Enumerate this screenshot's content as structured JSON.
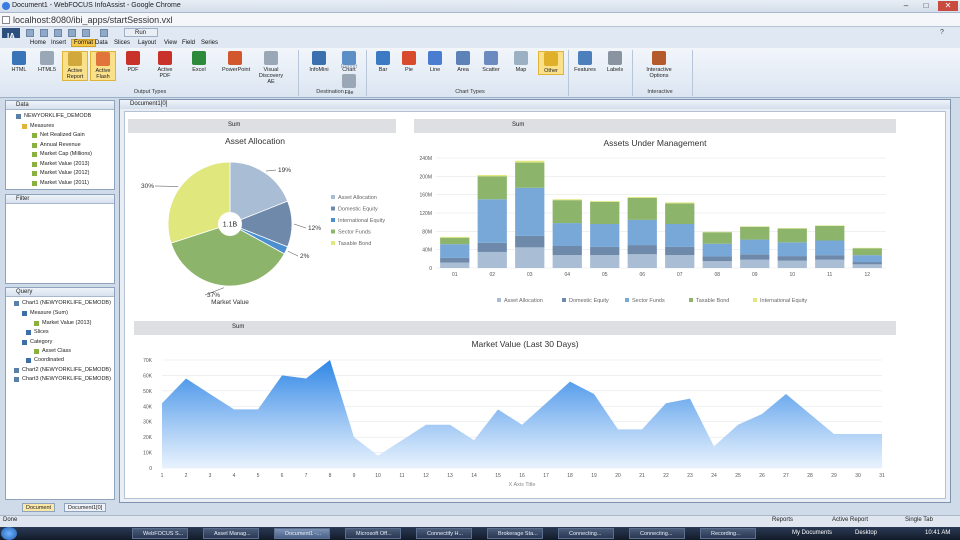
{
  "browser": {
    "title": "Document1 - WebFOCUS InfoAssist - Google Chrome",
    "url": "localhost:8080/ibi_apps/startSession.vxl"
  },
  "app": {
    "logo": "IA",
    "run_label": "Run",
    "menus": [
      "Home",
      "Insert",
      "Format",
      "Data",
      "Slices",
      "Layout",
      "View",
      "Field",
      "Series"
    ],
    "active_menu": "Format",
    "ribbon": {
      "output_types": [
        "HTML",
        "HTML5",
        "Active Report",
        "Active Flash",
        "PDF",
        "Active PDF",
        "Excel",
        "PowerPoint",
        "Visual Discovery AE"
      ],
      "destination": [
        "InfoMini",
        "Chart",
        "Report",
        "File"
      ],
      "chart_types": [
        "Bar",
        "Pie",
        "Line",
        "Area",
        "Scatter",
        "Map",
        "Other"
      ],
      "features": [
        "Features",
        "Labels"
      ],
      "interactive": [
        "Interactive Options"
      ],
      "groups": [
        "Output Types",
        "Destination",
        "Chart Types",
        "Interactive"
      ]
    }
  },
  "panels": {
    "data_label": "Data",
    "filter_label": "Filter",
    "query_label": "Query",
    "data_tree": [
      "NEWYORKLIFE_DEMODB",
      "Measures",
      "Net Realized Gain",
      "Annual Revenue",
      "Market Cap (Millions)",
      "Market Value (2013)",
      "Market Value (2012)",
      "Market Value (2011)"
    ],
    "query_tree": [
      "Chart1 (NEWYORKLIFE_DEMODB)",
      "Measure (Sum)",
      "Market Value (2013)",
      "Slices",
      "Category",
      "Asset Class",
      "Coordinated",
      "Chart2 (NEWYORKLIFE_DEMODB)",
      "Chart3 (NEWYORKLIFE_DEMODB)"
    ],
    "bottom_tabs": [
      "Document",
      "Document1[0]"
    ]
  },
  "document": {
    "tab_label": "Document1[0]",
    "toolbar_sum": "Sum"
  },
  "chart_data": [
    {
      "type": "pie",
      "title": "Asset Allocation",
      "center_label": "1.1B",
      "xlabel": "Market Value",
      "slices": [
        {
          "label": "Asset Allocation",
          "pct": 19,
          "color": "#a9bdd4"
        },
        {
          "label": "Domestic Equity",
          "pct": 12,
          "color": "#6e89aa"
        },
        {
          "label": "International Equity",
          "pct": 2,
          "color": "#4b8fd1"
        },
        {
          "label": "Sector Funds",
          "pct": 37,
          "color": "#8cb46a"
        },
        {
          "label": "Taxable Bond",
          "pct": 30,
          "color": "#dfe77d"
        }
      ],
      "slice_labels": [
        "19%",
        "12%",
        "2%",
        "37%",
        "30%"
      ],
      "legend": [
        "Asset Allocation",
        "Domestic Equity",
        "International Equity",
        "Sector Funds",
        "Taxable Bond"
      ]
    },
    {
      "type": "bar",
      "title": "Assets Under Management",
      "categories": [
        "01",
        "02",
        "03",
        "04",
        "05",
        "06",
        "07",
        "08",
        "09",
        "10",
        "11",
        "12"
      ],
      "ylim": [
        0,
        240
      ],
      "yticks": [
        "0",
        "40M",
        "80M",
        "120M",
        "160M",
        "200M",
        "240M"
      ],
      "series": [
        {
          "name": "Asset Allocation",
          "color": "#a9bdd4",
          "values": [
            12,
            35,
            45,
            28,
            28,
            30,
            28,
            15,
            18,
            16,
            18,
            8
          ]
        },
        {
          "name": "Domestic Equity",
          "color": "#6e89aa",
          "values": [
            10,
            20,
            25,
            20,
            18,
            20,
            18,
            10,
            12,
            10,
            10,
            5
          ]
        },
        {
          "name": "Sector Funds",
          "color": "#77a8d8",
          "values": [
            30,
            95,
            105,
            50,
            50,
            55,
            50,
            28,
            32,
            30,
            32,
            15
          ]
        },
        {
          "name": "Taxable Bond",
          "color": "#8cb46a",
          "values": [
            14,
            50,
            55,
            50,
            48,
            48,
            45,
            25,
            28,
            30,
            32,
            15
          ]
        },
        {
          "name": "International Equity",
          "color": "#dfe77d",
          "values": [
            2,
            3,
            4,
            2,
            2,
            2,
            2,
            1,
            1,
            1,
            1,
            1
          ]
        }
      ],
      "legend": [
        "Asset Allocation",
        "Domestic Equity",
        "Sector Funds",
        "Taxable Bond",
        "International Equity"
      ]
    },
    {
      "type": "area",
      "title": "Market Value (Last 30 Days)",
      "xlabel": "X Axis Title",
      "x": [
        "1",
        "2",
        "3",
        "4",
        "5",
        "6",
        "7",
        "8",
        "9",
        "10",
        "11",
        "12",
        "13",
        "14",
        "15",
        "16",
        "17",
        "18",
        "19",
        "20",
        "21",
        "22",
        "23",
        "24",
        "25",
        "26",
        "27",
        "28",
        "29",
        "30",
        "31"
      ],
      "values": [
        42,
        58,
        48,
        38,
        38,
        60,
        58,
        70,
        20,
        8,
        18,
        28,
        28,
        18,
        38,
        28,
        42,
        56,
        48,
        25,
        25,
        42,
        45,
        14,
        28,
        35,
        48,
        35,
        22,
        22,
        22
      ],
      "ylim": [
        0,
        70
      ],
      "yticks": [
        "0",
        "10K",
        "20K",
        "30K",
        "40K",
        "50K",
        "60K",
        "70K"
      ],
      "color": "#2f86e6"
    }
  ],
  "statusbar": {
    "left": "Done",
    "items": [
      "Reports",
      "Active Report",
      "Single Tab"
    ]
  },
  "taskbar": {
    "buttons": [
      "WebFOCUS S...",
      "Asset Manag...",
      "Document1 -...",
      "Microsoft Off...",
      "Connectify H...",
      "Brokerage Sta...",
      "Connecting...",
      "Connecting...",
      "Recording..."
    ],
    "tray_left": "My Documents",
    "tray_desktop": "Desktop",
    "clock": "10:41 AM"
  }
}
